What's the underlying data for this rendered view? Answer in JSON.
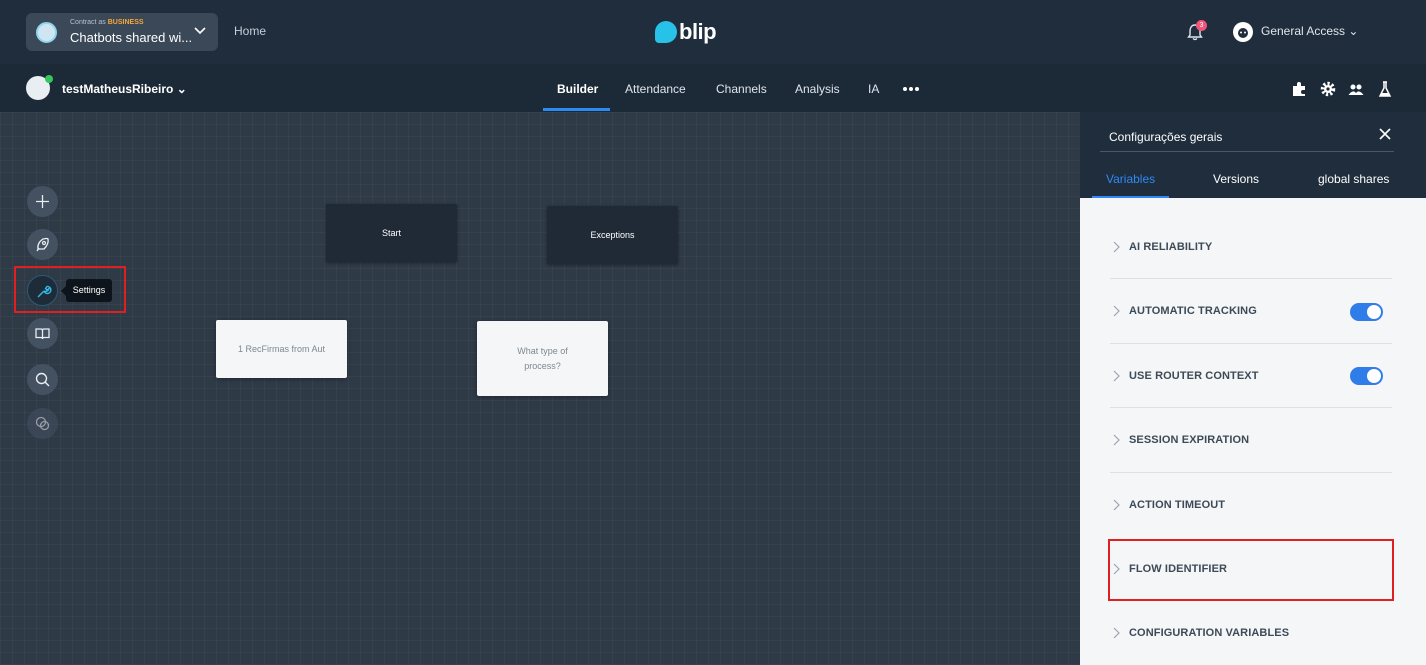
{
  "topbar": {
    "contract_prefix": "Contract as",
    "contract_plan": "BUSINESS",
    "contract_name": "Chatbots shared wi...",
    "home_label": "Home",
    "logo_text": "blip",
    "notification_count": "3",
    "account_name": "General Access"
  },
  "subbar": {
    "bot_name": "testMatheusRibeiro",
    "tabs": [
      {
        "label": "Builder",
        "active": true
      },
      {
        "label": "Attendance"
      },
      {
        "label": "Channels"
      },
      {
        "label": "Analysis"
      },
      {
        "label": "IA"
      }
    ],
    "more_icon": "more-dots-icon",
    "tools": [
      "puzzle-icon",
      "gear-icon",
      "users-icon",
      "flask-icon"
    ]
  },
  "canvas": {
    "tools": [
      "plus-icon",
      "rocket-icon",
      "wrench-icon",
      "book-icon",
      "search-icon",
      "tag-icon"
    ],
    "tooltip": "Settings",
    "blocks": {
      "start": "Start",
      "exceptions": "Exceptions",
      "recfirmas": "1 RecFirmas from Aut",
      "what_type_line1": "What type of",
      "what_type_line2": "process?"
    }
  },
  "panel": {
    "title": "Configurações gerais",
    "tabs": [
      {
        "label": "Variables",
        "active": true
      },
      {
        "label": "Versions"
      },
      {
        "label": "global shares"
      }
    ],
    "items": [
      {
        "label": "AI RELIABILITY",
        "toggle": null
      },
      {
        "label": "AUTOMATIC TRACKING",
        "toggle": true
      },
      {
        "label": "USE ROUTER CONTEXT",
        "toggle": true
      },
      {
        "label": "SESSION EXPIRATION",
        "toggle": null
      },
      {
        "label": "ACTION TIMEOUT",
        "toggle": null
      },
      {
        "label": "FLOW IDENTIFIER",
        "toggle": null
      },
      {
        "label": "CONFIGURATION VARIABLES",
        "toggle": null
      }
    ]
  },
  "colors": {
    "topbar": "#1f2d3c",
    "canvas": "#2f3a47",
    "accent": "#2f8af5",
    "highlight": "#e02020",
    "toggle_on": "#2f7de8"
  }
}
